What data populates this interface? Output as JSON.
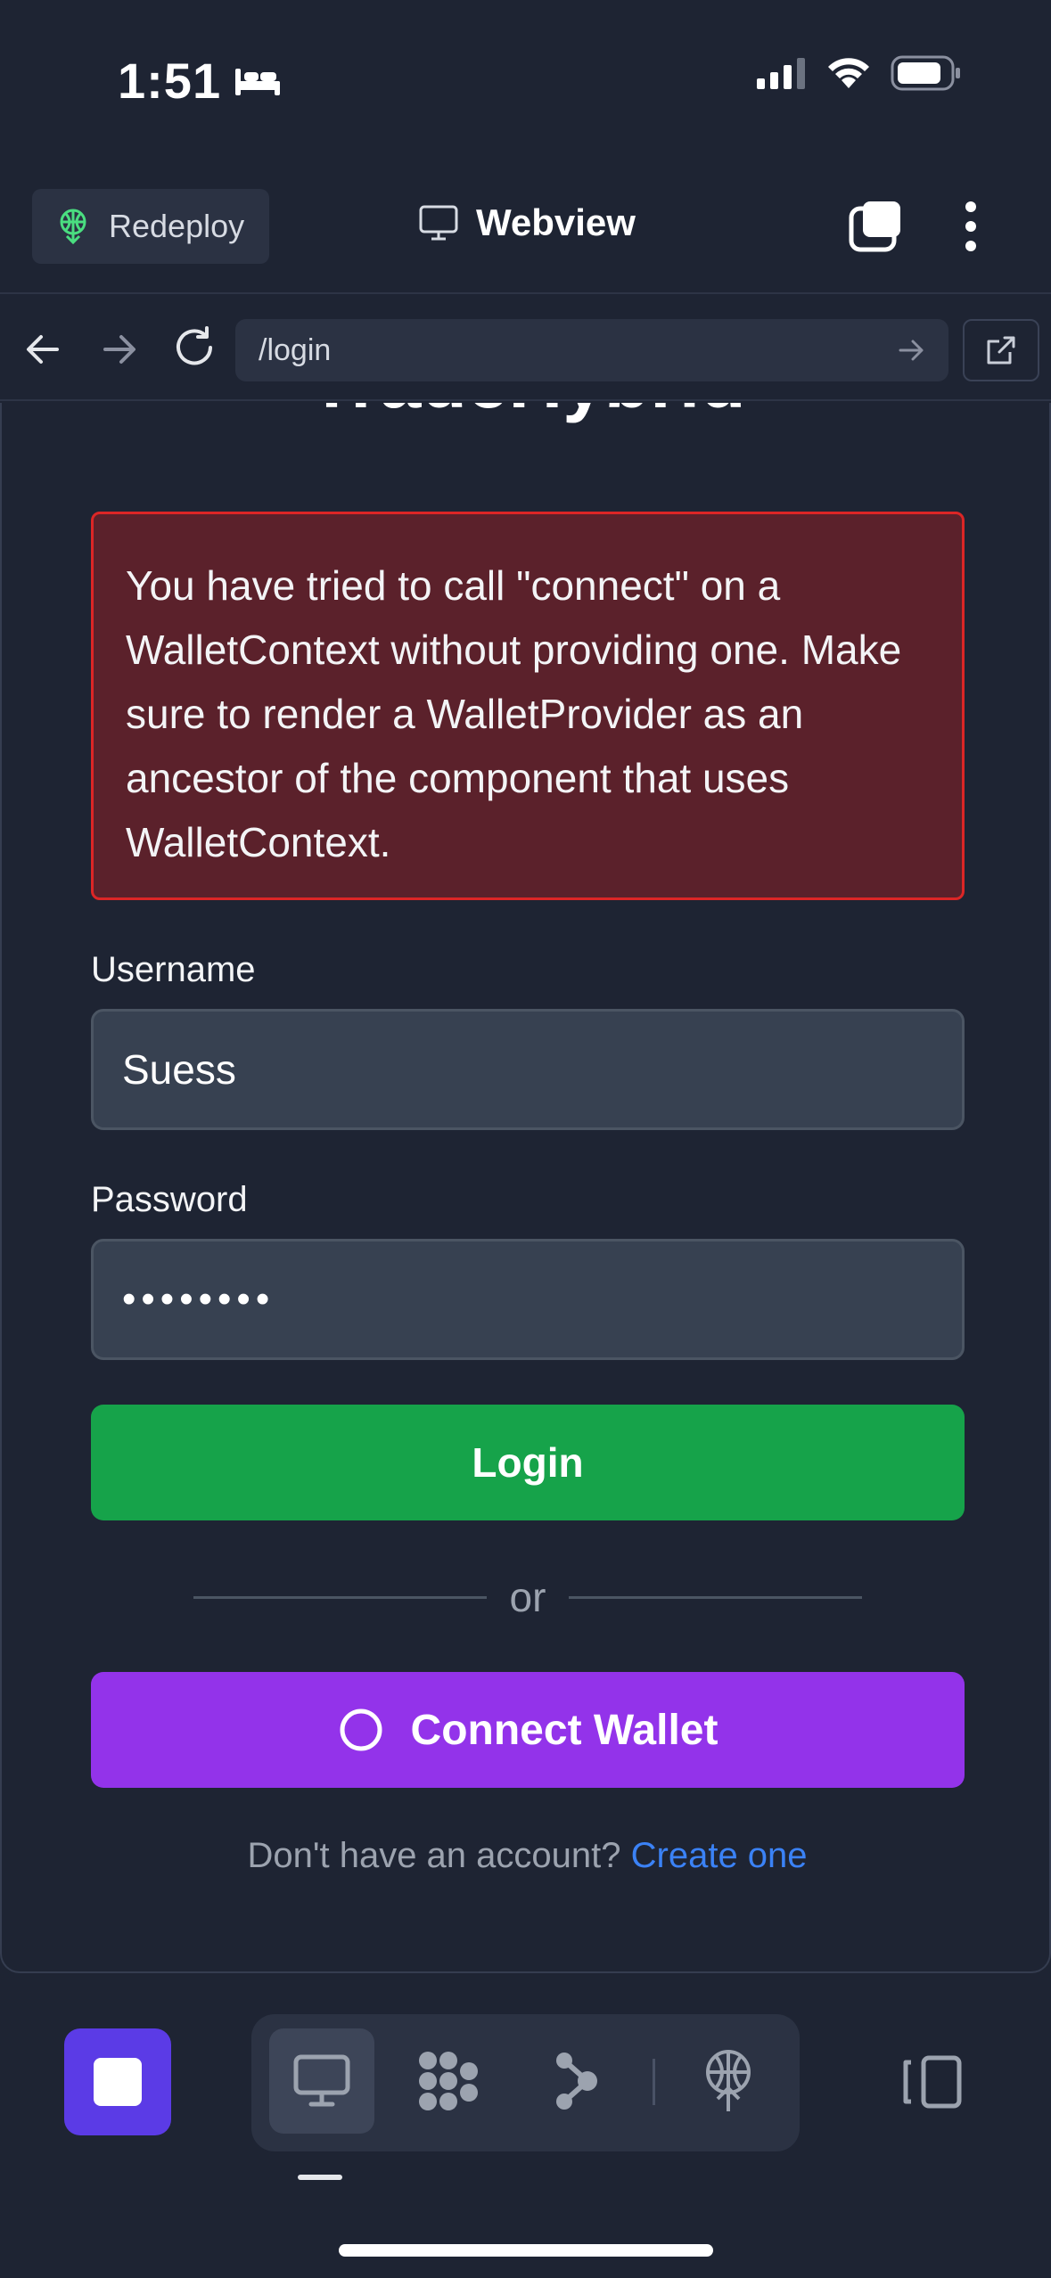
{
  "status_bar": {
    "time": "1:51"
  },
  "app_bar": {
    "redeploy_label": "Redeploy",
    "title": "Webview"
  },
  "url_bar": {
    "url": "/login"
  },
  "page": {
    "brand": "TradeHybrid",
    "error_message": "You have tried to call \"connect\" on a WalletContext without providing one. Make sure to render a WalletProvider as an ancestor of the component that uses WalletContext.",
    "username_label": "Username",
    "username_value": "Suess",
    "password_label": "Password",
    "password_value": "••••••••",
    "login_label": "Login",
    "divider_text": "or",
    "wallet_label": "Connect Wallet",
    "signup_prompt": "Don't have an account?",
    "signup_link": "Create one"
  },
  "bottom_bar": {
    "tools": [
      "webview-icon",
      "packages-icon",
      "graph-icon",
      "deploy-icon"
    ],
    "active_tool": "webview-icon"
  },
  "colors": {
    "background": "#1e2433",
    "error_bg": "#5b212b",
    "error_border": "#dc2626",
    "login_green": "#16a34a",
    "wallet_purple": "#9333ea",
    "link_blue": "#3b82f6",
    "stop_purple": "#5b3be6"
  }
}
